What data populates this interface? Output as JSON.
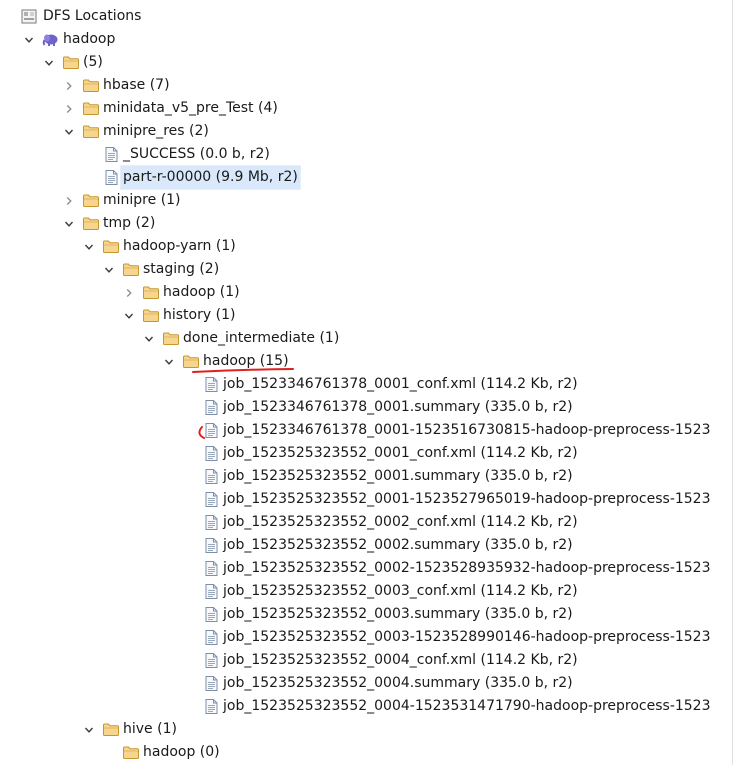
{
  "tree": {
    "rows": [
      {
        "id": "dfs-locations",
        "label": "DFS Locations",
        "depth": 0,
        "type": "dfs",
        "twisty": "none"
      },
      {
        "id": "hadoop-root",
        "label": "hadoop",
        "depth": 1,
        "type": "elephant",
        "twisty": "open"
      },
      {
        "id": "root-folder",
        "label": "(5)",
        "depth": 2,
        "type": "folder",
        "twisty": "open"
      },
      {
        "id": "hbase",
        "label": "hbase (7)",
        "depth": 3,
        "type": "folder",
        "twisty": "closed"
      },
      {
        "id": "minidata",
        "label": "minidata_v5_pre_Test (4)",
        "depth": 3,
        "type": "folder",
        "twisty": "closed"
      },
      {
        "id": "minipre-res",
        "label": "minipre_res (2)",
        "depth": 3,
        "type": "folder",
        "twisty": "open"
      },
      {
        "id": "success",
        "label": "_SUCCESS (0.0 b, r2)",
        "depth": 4,
        "type": "file",
        "twisty": "none"
      },
      {
        "id": "part-r",
        "label": "part-r-00000 (9.9 Mb, r2)",
        "depth": 4,
        "type": "file",
        "twisty": "none",
        "selected": true
      },
      {
        "id": "minipre",
        "label": "minipre (1)",
        "depth": 3,
        "type": "folder",
        "twisty": "closed"
      },
      {
        "id": "tmp",
        "label": "tmp (2)",
        "depth": 3,
        "type": "folder",
        "twisty": "open"
      },
      {
        "id": "hadoop-yarn",
        "label": "hadoop-yarn (1)",
        "depth": 4,
        "type": "folder",
        "twisty": "open"
      },
      {
        "id": "staging",
        "label": "staging (2)",
        "depth": 5,
        "type": "folder",
        "twisty": "open"
      },
      {
        "id": "staging-hadoop",
        "label": "hadoop (1)",
        "depth": 6,
        "type": "folder",
        "twisty": "closed"
      },
      {
        "id": "history",
        "label": "history (1)",
        "depth": 6,
        "type": "folder",
        "twisty": "open"
      },
      {
        "id": "done-intermediate",
        "label": "done_intermediate (1)",
        "depth": 7,
        "type": "folder",
        "twisty": "open"
      },
      {
        "id": "di-hadoop",
        "label": "hadoop (15)",
        "depth": 8,
        "type": "folder",
        "twisty": "open",
        "underline": true
      },
      {
        "id": "f1",
        "label": "job_1523346761378_0001_conf.xml (114.2 Kb, r2)",
        "depth": 9,
        "type": "file",
        "twisty": "none"
      },
      {
        "id": "f2",
        "label": "job_1523346761378_0001.summary (335.0 b, r2)",
        "depth": 9,
        "type": "file",
        "twisty": "none"
      },
      {
        "id": "f3",
        "label": "job_1523346761378_0001-1523516730815-hadoop-preprocess-1523",
        "depth": 9,
        "type": "file",
        "twisty": "none",
        "mark": true
      },
      {
        "id": "f4",
        "label": "job_1523525323552_0001_conf.xml (114.2 Kb, r2)",
        "depth": 9,
        "type": "file",
        "twisty": "none"
      },
      {
        "id": "f5",
        "label": "job_1523525323552_0001.summary (335.0 b, r2)",
        "depth": 9,
        "type": "file",
        "twisty": "none"
      },
      {
        "id": "f6",
        "label": "job_1523525323552_0001-1523527965019-hadoop-preprocess-1523",
        "depth": 9,
        "type": "file",
        "twisty": "none"
      },
      {
        "id": "f7",
        "label": "job_1523525323552_0002_conf.xml (114.2 Kb, r2)",
        "depth": 9,
        "type": "file",
        "twisty": "none"
      },
      {
        "id": "f8",
        "label": "job_1523525323552_0002.summary (335.0 b, r2)",
        "depth": 9,
        "type": "file",
        "twisty": "none"
      },
      {
        "id": "f9",
        "label": "job_1523525323552_0002-1523528935932-hadoop-preprocess-1523",
        "depth": 9,
        "type": "file",
        "twisty": "none"
      },
      {
        "id": "f10",
        "label": "job_1523525323552_0003_conf.xml (114.2 Kb, r2)",
        "depth": 9,
        "type": "file",
        "twisty": "none"
      },
      {
        "id": "f11",
        "label": "job_1523525323552_0003.summary (335.0 b, r2)",
        "depth": 9,
        "type": "file",
        "twisty": "none"
      },
      {
        "id": "f12",
        "label": "job_1523525323552_0003-1523528990146-hadoop-preprocess-1523",
        "depth": 9,
        "type": "file",
        "twisty": "none"
      },
      {
        "id": "f13",
        "label": "job_1523525323552_0004_conf.xml (114.2 Kb, r2)",
        "depth": 9,
        "type": "file",
        "twisty": "none"
      },
      {
        "id": "f14",
        "label": "job_1523525323552_0004.summary (335.0 b, r2)",
        "depth": 9,
        "type": "file",
        "twisty": "none"
      },
      {
        "id": "f15",
        "label": "job_1523525323552_0004-1523531471790-hadoop-preprocess-1523",
        "depth": 9,
        "type": "file",
        "twisty": "none"
      },
      {
        "id": "hive",
        "label": "hive (1)",
        "depth": 4,
        "type": "folder",
        "twisty": "open"
      },
      {
        "id": "hive-hadoop",
        "label": "hadoop (0)",
        "depth": 5,
        "type": "folder",
        "twisty": "none"
      }
    ]
  },
  "icons": {
    "folder": "folder-icon",
    "file": "file-icon",
    "elephant": "hadoop-elephant-icon",
    "dfs": "dfs-locations-icon",
    "open": "chevron-down-icon",
    "closed": "chevron-right-icon"
  },
  "colors": {
    "folder_fill": "#f6d58e",
    "folder_stroke": "#c8962e",
    "file_stroke": "#7c8ea8",
    "elephant": "#6f62c8",
    "annotation": "#e02020",
    "selection": "#d9e8fb"
  }
}
